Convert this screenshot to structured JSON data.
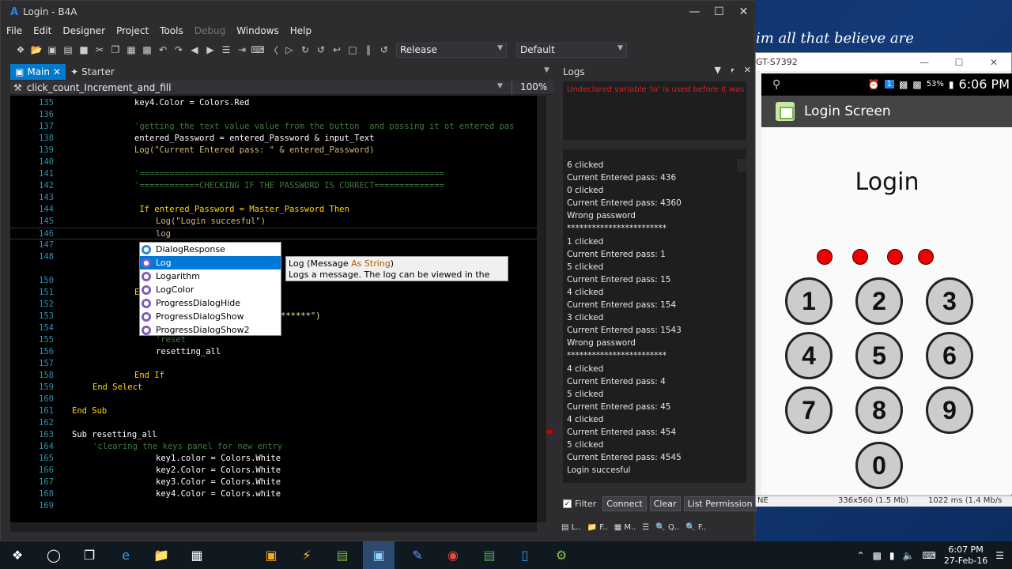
{
  "desktop": {
    "caption": "im all that believe are"
  },
  "window": {
    "title": "Login - B4A",
    "app_letter": "A"
  },
  "menu": [
    "File",
    "Edit",
    "Designer",
    "Project",
    "Tools",
    "Debug",
    "Windows",
    "Help"
  ],
  "toolbar": {
    "build_mode": "Release",
    "config": "Default"
  },
  "tabs": {
    "main": "Main",
    "starter": "Starter"
  },
  "subbar": {
    "sub_name": "click_count_Increment_and_fill",
    "zoom": "100%"
  },
  "code": [
    {
      "n": "135",
      "t": "key4.Color = Colors.Red"
    },
    {
      "n": "136",
      "t": ""
    },
    {
      "n": "137",
      "t": "'getting the text value value from the button  and passing it ot entered pas"
    },
    {
      "n": "138",
      "t": "entered_Password = entered_Password & input_Text"
    },
    {
      "n": "139",
      "t": "Log(\"Current Entered pass: \" & entered_Password)"
    },
    {
      "n": "140",
      "t": ""
    },
    {
      "n": "141",
      "t": "'============================================================="
    },
    {
      "n": "142",
      "t": "'============CHECKING IF THE PASSWORD IS CORRECT=============="
    },
    {
      "n": "143",
      "t": ""
    },
    {
      "n": "144",
      "t": " If entered_Password = Master_Password Then"
    },
    {
      "n": "145",
      "t": "Log(\"Login succesful\")"
    },
    {
      "n": "146",
      "t": "log"
    },
    {
      "n": "147",
      "t": ""
    },
    {
      "n": "148",
      "t": ""
    },
    {
      "n": "150",
      "t": ""
    },
    {
      "n": "151",
      "t": "E"
    },
    {
      "n": "152",
      "t": ""
    },
    {
      "n": "153",
      "t": "******\")"
    },
    {
      "n": "154",
      "t": ""
    },
    {
      "n": "155",
      "t": "'reset"
    },
    {
      "n": "156",
      "t": "resetting_all"
    },
    {
      "n": "157",
      "t": ""
    },
    {
      "n": "158",
      "t": "End If"
    },
    {
      "n": "159",
      "t": "End Select"
    },
    {
      "n": "160",
      "t": ""
    },
    {
      "n": "161",
      "t": "End Sub"
    },
    {
      "n": "162",
      "t": ""
    },
    {
      "n": "163",
      "t": "Sub resetting_all"
    },
    {
      "n": "164",
      "t": "'clearing the keys panel for new entry"
    },
    {
      "n": "165",
      "t": "key1.color = Colors.White"
    },
    {
      "n": "166",
      "t": "key2.Color = Colors.White"
    },
    {
      "n": "167",
      "t": "key3.Color = Colors.White"
    },
    {
      "n": "168",
      "t": "key4.Color = Colors.white"
    },
    {
      "n": "169",
      "t": ""
    }
  ],
  "autocomplete": {
    "items": [
      "DialogResponse",
      "Log",
      "Logarithm",
      "LogColor",
      "ProgressDialogHide",
      "ProgressDialogShow",
      "ProgressDialogShow2"
    ],
    "selected_index": 1,
    "tip_name": "Log",
    "tip_sig_pre": "(Message ",
    "tip_as": "As String",
    "tip_sig_post": ")",
    "tip_desc": "Logs a message. The log can be viewed in the Logs tab."
  },
  "logs": {
    "title": "Logs",
    "error": "Undeclared variable 'lo' is used before it was a",
    "entries": [
      "6 clicked",
      "Current Entered pass: 436",
      "0 clicked",
      "Current Entered pass: 4360",
      "Wrong password",
      "************************",
      "1 clicked",
      "Current Entered pass: 1",
      "5 clicked",
      "Current Entered pass: 15",
      "4 clicked",
      "Current Entered pass: 154",
      "3 clicked",
      "Current Entered pass: 1543",
      "Wrong password",
      "************************",
      "4 clicked",
      "Current Entered pass: 4",
      "5 clicked",
      "Current Entered pass: 45",
      "4 clicked",
      "Current Entered pass: 454",
      "5 clicked",
      "Current Entered pass: 4545",
      "Login succesful"
    ],
    "filter_label": "Filter",
    "connect_label": "Connect",
    "clear_label": "Clear",
    "list_perm_label": "List Permission",
    "bottom_tabs": [
      "L..",
      "F..",
      "M..",
      "",
      "Q..",
      "F.."
    ]
  },
  "emulator": {
    "title": "GT-S7392",
    "time": "6:06 PM",
    "battery": "53%",
    "app_title": "Login Screen",
    "login_label": "Login",
    "keys": [
      "1",
      "2",
      "3",
      "4",
      "5",
      "6",
      "7",
      "8",
      "9",
      "0"
    ],
    "status_left": "NE",
    "status_mid": "336x560 (1.5 Mb)",
    "status_right": "1022 ms (1.4 Mb/s"
  },
  "taskbar": {
    "time": "6:07 PM",
    "date": "27-Feb-16"
  }
}
